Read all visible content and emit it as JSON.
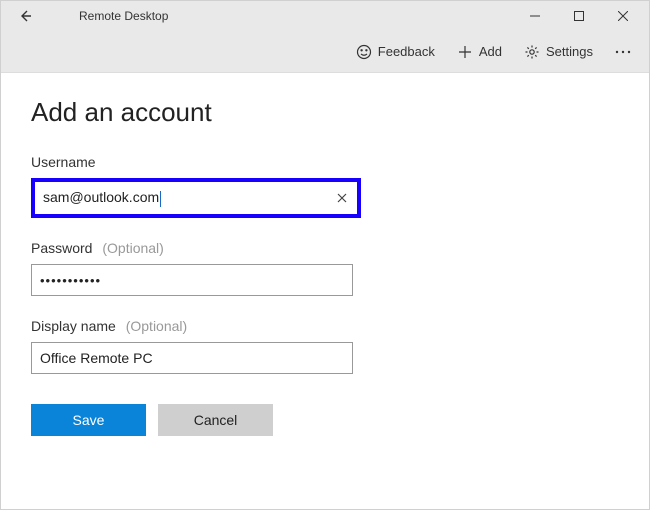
{
  "window": {
    "title": "Remote Desktop"
  },
  "commands": {
    "feedback": "Feedback",
    "add": "Add",
    "settings": "Settings"
  },
  "page": {
    "heading": "Add an account"
  },
  "fields": {
    "username": {
      "label": "Username",
      "value": "sam@outlook.com"
    },
    "password": {
      "label": "Password",
      "optional": "(Optional)",
      "mask": "•••••••••••"
    },
    "displayname": {
      "label": "Display name",
      "optional": "(Optional)",
      "value": "Office Remote PC"
    }
  },
  "buttons": {
    "save": "Save",
    "cancel": "Cancel"
  }
}
